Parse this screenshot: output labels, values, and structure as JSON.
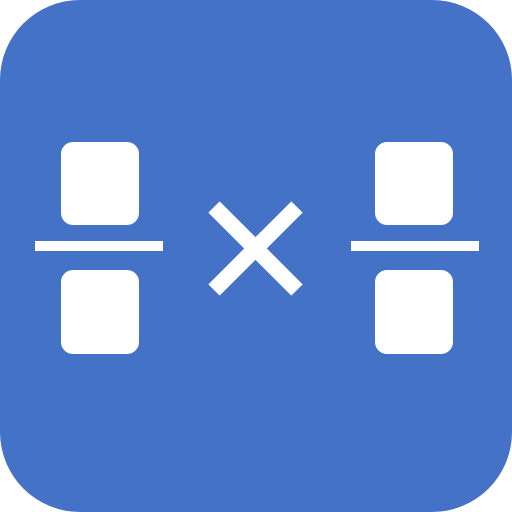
{
  "icon": {
    "name": "fraction-multiplication-icon",
    "background_color": "#4472c6",
    "foreground_color": "#ffffff",
    "left_fraction": {
      "numerator_box": "empty",
      "denominator_box": "empty"
    },
    "operator": "multiply",
    "right_fraction": {
      "numerator_box": "empty",
      "denominator_box": "empty"
    }
  }
}
